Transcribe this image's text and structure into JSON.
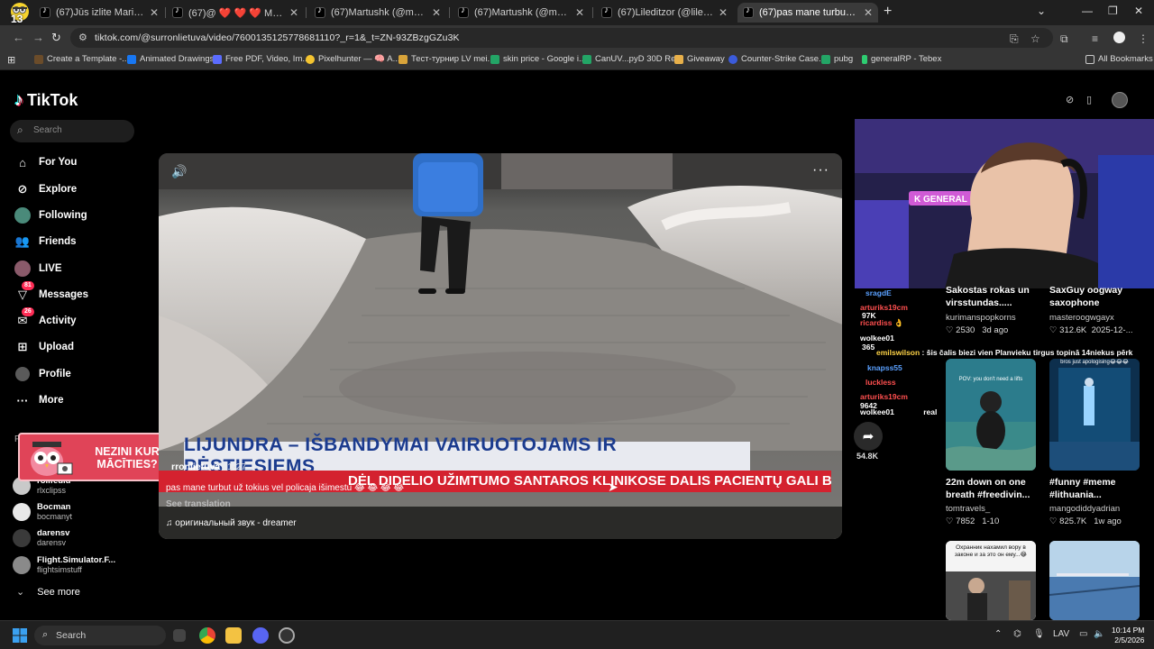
{
  "browser": {
    "tabs": [
      {
        "title": "(67)Jūs izlite Marija Larssone (@"
      },
      {
        "title": "(67)@ ❤️ ❤️ ❤️ Milošā sirds ❤️ ❤️"
      },
      {
        "title": "(67)Martushk (@martushk)'s vid"
      },
      {
        "title": "(67)Martushk (@martushk)'s vid"
      },
      {
        "title": "(67)Lileditzor (@lileditzor)'s vid"
      },
      {
        "title": "(67)pas mane turbut už tokius"
      }
    ],
    "profile_badge": "13",
    "url": "tiktok.com/@surronlietuva/video/7600135125778681110?_r=1&_t=ZN-93ZBzgGZu3K",
    "bookmarks": [
      {
        "label": "Create a Template -...",
        "color": "#6b4c2a"
      },
      {
        "label": "Animated Drawings",
        "color": "#1877f2"
      },
      {
        "label": "Free PDF, Video, Im...",
        "color": "#5b6cff"
      },
      {
        "label": "Pixelhunter — 🧠 A...",
        "color": "#f4c430"
      },
      {
        "label": "Тест-турнир LV mei...",
        "color": "#d9a43a"
      },
      {
        "label": "skin price - Google i...",
        "color": "#23a566"
      },
      {
        "label": "CanUV...pyD 30D Re...",
        "color": "#23a566"
      },
      {
        "label": "Giveaway",
        "color": "#e8b04a"
      },
      {
        "label": "Counter-Strike Case...",
        "color": "#3b5bdb"
      },
      {
        "label": "pubg",
        "color": "#23a566"
      },
      {
        "label": "generalRP - Tebex",
        "color": "#2ecc71"
      }
    ],
    "all_bookmarks": "All Bookmarks"
  },
  "tiktok": {
    "brand": "TikTok",
    "search_placeholder": "Search",
    "nav": [
      {
        "label": "For You",
        "icon": "home-icon"
      },
      {
        "label": "Explore",
        "icon": "compass-icon"
      },
      {
        "label": "Following",
        "icon": "following-icon"
      },
      {
        "label": "Friends",
        "icon": "friends-icon"
      },
      {
        "label": "LIVE",
        "icon": "live-icon"
      },
      {
        "label": "Messages",
        "icon": "messages-icon",
        "badge": "81"
      },
      {
        "label": "Activity",
        "icon": "activity-icon",
        "badge": "26"
      },
      {
        "label": "Upload",
        "icon": "upload-icon"
      },
      {
        "label": "Profile",
        "icon": "profile-icon"
      },
      {
        "label": "More",
        "icon": "more-icon"
      }
    ],
    "following_heading": "Fo",
    "following_accounts": [
      {
        "name": "rolifeuld",
        "handle": "rlxclipss"
      },
      {
        "name": "Bocman",
        "handle": "bocmanyt"
      },
      {
        "name": "darensv",
        "handle": "darensv"
      },
      {
        "name": "Flight.Simulator.F...",
        "handle": "flightsimstuff"
      }
    ],
    "see_more": "See more",
    "promo_text": "NEZINI KUR MĀCĪTIES?",
    "video": {
      "banner_title": "LIJUNDRA – IŠBANDYMAI VAIRUOTOJAMS IR PĖSTIESIEMS",
      "banner_ticker": "DĖL DIDELIO UŽIMTUMO SANTAROS KLINIKOSE DALIS PACIENTŲ GALI B",
      "author": "rronlietuva",
      "date": "1-27",
      "caption": "pas mane turbut už tokius vel policaja išimestu 😂 😂 😂 😂",
      "see_translation": "See translation",
      "sound": "оригинальный звук - dreamer"
    },
    "share_count": "54.8K",
    "recommendations": [
      {
        "title": "Sakostas rokas un virsstundas.....",
        "author": "kurimanspopkorns",
        "likes": "2530",
        "date": "3d ago"
      },
      {
        "title": "SaxGuy oogway saxophone",
        "author": "masteroogwgayx",
        "likes": "312.6K",
        "date": "2025-12-..."
      },
      {
        "title": "22m down on one breath #freedivin...",
        "author": "tomtravels_",
        "likes": "7852",
        "date": "1-10"
      },
      {
        "title": "#funny #meme #lithuania...",
        "author": "mangodiddyadrian",
        "likes": "825.7K",
        "date": "1w ago"
      }
    ],
    "thumb_texts": {
      "freedive": "POV: you don't need a lifts",
      "stage": "bros just apologising😂😂😂",
      "russian": "Охранник нахамил вору в законе и за это он ему...😂"
    }
  },
  "stream_chat": [
    {
      "user": "sragdE",
      "color": "#5aa0ff",
      "msg": ""
    },
    {
      "user": "arturiks19cm",
      "color": "#ff4f4f",
      "msg": ""
    },
    {
      "user": "97K",
      "color": "#ffffff",
      "msg": ""
    },
    {
      "user": "ricardiss",
      "color": "#ff4f4f",
      "msg": "👌"
    },
    {
      "user": "wolkee01",
      "color": "#ffffff",
      "msg": ""
    },
    {
      "user": "365",
      "color": "#ffffff",
      "msg": ""
    },
    {
      "user": "emilswilson",
      "color": "#ffd447",
      "msg": "šis čalis biezi vien Planvieku tirgus topinā 14niekus pērk"
    },
    {
      "user": "knapss55",
      "color": "#5aa0ff",
      "msg": ""
    },
    {
      "user": "luckless",
      "color": "#ff4f4f",
      "msg": ""
    },
    {
      "user": "arturiks19cm",
      "color": "#ff4f4f",
      "msg": ""
    },
    {
      "user": "9642",
      "color": "#ffffff",
      "msg": ""
    },
    {
      "user": "wolkee01",
      "color": "#ffffff",
      "msg": "real"
    }
  ],
  "webcam": {
    "sign_text": "K GENERAL"
  },
  "taskbar": {
    "search_placeholder": "Search",
    "lang": "LAV",
    "time": "10:14 PM",
    "date": "2/5/2026"
  }
}
